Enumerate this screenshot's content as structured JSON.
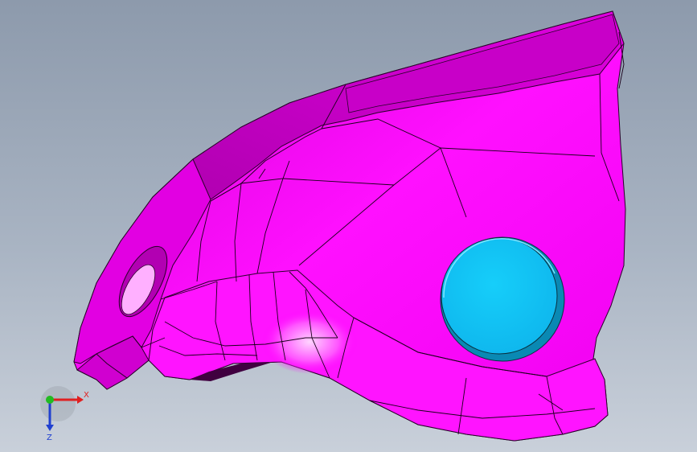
{
  "viewport": {
    "background_top": "#8d9aac",
    "background_bottom": "#c9d0da"
  },
  "model": {
    "part_color": "#ff00ff",
    "part_shadow_color": "#a800a8",
    "part_highlight_color": "#ffc8ff",
    "edge_color": "#1a001a",
    "boss_color": "#10c6f8",
    "boss_rim_color": "#0a89b3"
  },
  "triad": {
    "x_label": "X",
    "z_label": "Z",
    "x_color": "#e02020",
    "y_color": "#22bb22",
    "z_color": "#2040d0",
    "y_axis_icon": "y-axis-dot-icon"
  }
}
